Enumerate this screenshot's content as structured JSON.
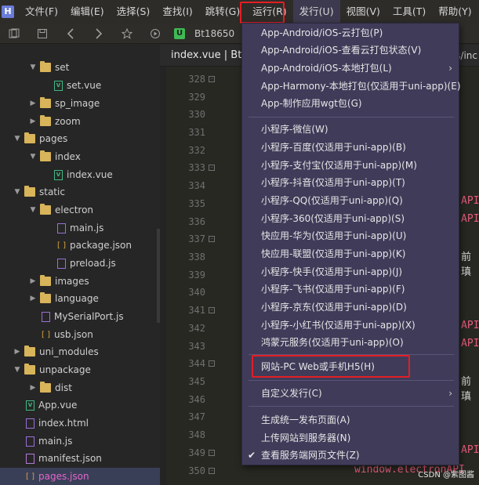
{
  "menubar": {
    "logo": "H",
    "items": [
      "文件(F)",
      "编辑(E)",
      "选择(S)",
      "查找(I)",
      "跳转(G)",
      "运行(R)",
      "发行(U)",
      "视图(V)",
      "工具(T)",
      "帮助(Y)"
    ]
  },
  "toolbar": {
    "icons": [
      "files-icon",
      "save-icon",
      "back-icon",
      "forward-icon",
      "star-icon",
      "run-icon"
    ],
    "u_badge": "U",
    "crumb": "Bt18650"
  },
  "sidebar": {
    "items": [
      {
        "label": "set",
        "type": "folder",
        "expanded": true
      },
      {
        "label": "set.vue",
        "type": "vue"
      },
      {
        "label": "sp_image",
        "type": "folder",
        "expanded": false
      },
      {
        "label": "zoom",
        "type": "folder",
        "expanded": false
      },
      {
        "label": "pages",
        "type": "folder",
        "expanded": true
      },
      {
        "label": "index",
        "type": "folder",
        "expanded": true
      },
      {
        "label": "index.vue",
        "type": "vue"
      },
      {
        "label": "static",
        "type": "folder",
        "expanded": true
      },
      {
        "label": "electron",
        "type": "folder",
        "expanded": true
      },
      {
        "label": "main.js",
        "type": "js"
      },
      {
        "label": "package.json",
        "type": "json"
      },
      {
        "label": "preload.js",
        "type": "js"
      },
      {
        "label": "images",
        "type": "folder",
        "expanded": false
      },
      {
        "label": "language",
        "type": "folder",
        "expanded": false
      },
      {
        "label": "MySerialPort.js",
        "type": "js"
      },
      {
        "label": "usb.json",
        "type": "json"
      },
      {
        "label": "uni_modules",
        "type": "folder",
        "expanded": false
      },
      {
        "label": "unpackage",
        "type": "folder",
        "expanded": true
      },
      {
        "label": "dist",
        "type": "folder",
        "expanded": false
      },
      {
        "label": "App.vue",
        "type": "vue"
      },
      {
        "label": "index.html",
        "type": "html"
      },
      {
        "label": "main.js",
        "type": "js"
      },
      {
        "label": "manifest.json",
        "type": "manifest"
      },
      {
        "label": "pages.json",
        "type": "json",
        "selected": true
      }
    ]
  },
  "editor": {
    "tab_label": "index.vue | Bt1",
    "tab_right": "s/inc",
    "line_numbers": [
      "328",
      "329",
      "330",
      "331",
      "332",
      "333",
      "334",
      "335",
      "336",
      "337",
      "338",
      "339",
      "340",
      "341",
      "342",
      "343",
      "344",
      "345",
      "346",
      "347",
      "348",
      "349",
      "350"
    ],
    "code_snippets": [
      "API",
      "API",
      "前瑱",
      "API",
      "API",
      "前瑱",
      "API",
      "window.electronAPI"
    ]
  },
  "dropdown": {
    "items": [
      {
        "label": "App-Android/iOS-云打包(P)"
      },
      {
        "label": "App-Android/iOS-查看云打包状态(V)"
      },
      {
        "label": "App-Android/iOS-本地打包(L)",
        "submenu": true
      },
      {
        "label": "App-Harmony-本地打包(仅适用于uni-app)(E)"
      },
      {
        "label": "App-制作应用wgt包(G)"
      },
      {
        "label": "小程序-微信(W)"
      },
      {
        "label": "小程序-百度(仅适用于uni-app)(B)"
      },
      {
        "label": "小程序-支付宝(仅适用于uni-app)(M)"
      },
      {
        "label": "小程序-抖音(仅适用于uni-app)(T)"
      },
      {
        "label": "小程序-QQ(仅适用于uni-app)(Q)"
      },
      {
        "label": "小程序-360(仅适用于uni-app)(S)"
      },
      {
        "label": "快应用-华为(仅适用于uni-app)(U)"
      },
      {
        "label": "快应用-联盟(仅适用于uni-app)(K)"
      },
      {
        "label": "小程序-快手(仅适用于uni-app)(J)"
      },
      {
        "label": "小程序-飞书(仅适用于uni-app)(F)"
      },
      {
        "label": "小程序-京东(仅适用于uni-app)(D)"
      },
      {
        "label": "小程序-小红书(仅适用于uni-app)(X)"
      },
      {
        "label": "鸿蒙元服务(仅适用于uni-app)(O)"
      },
      {
        "label": "网站-PC Web或手机H5(H)"
      },
      {
        "label": "自定义发行(C)",
        "submenu": true
      },
      {
        "label": "生成统一发布页面(A)"
      },
      {
        "label": "上传网站到服务器(N)"
      },
      {
        "label": "查看服务端网页文件(Z)",
        "checked": true
      }
    ]
  },
  "watermark": "CSDN @紫图酱",
  "colors": {
    "menu_bg": "#403b59",
    "highlight_border": "#e31e24",
    "selected_file": "#e267c9"
  }
}
